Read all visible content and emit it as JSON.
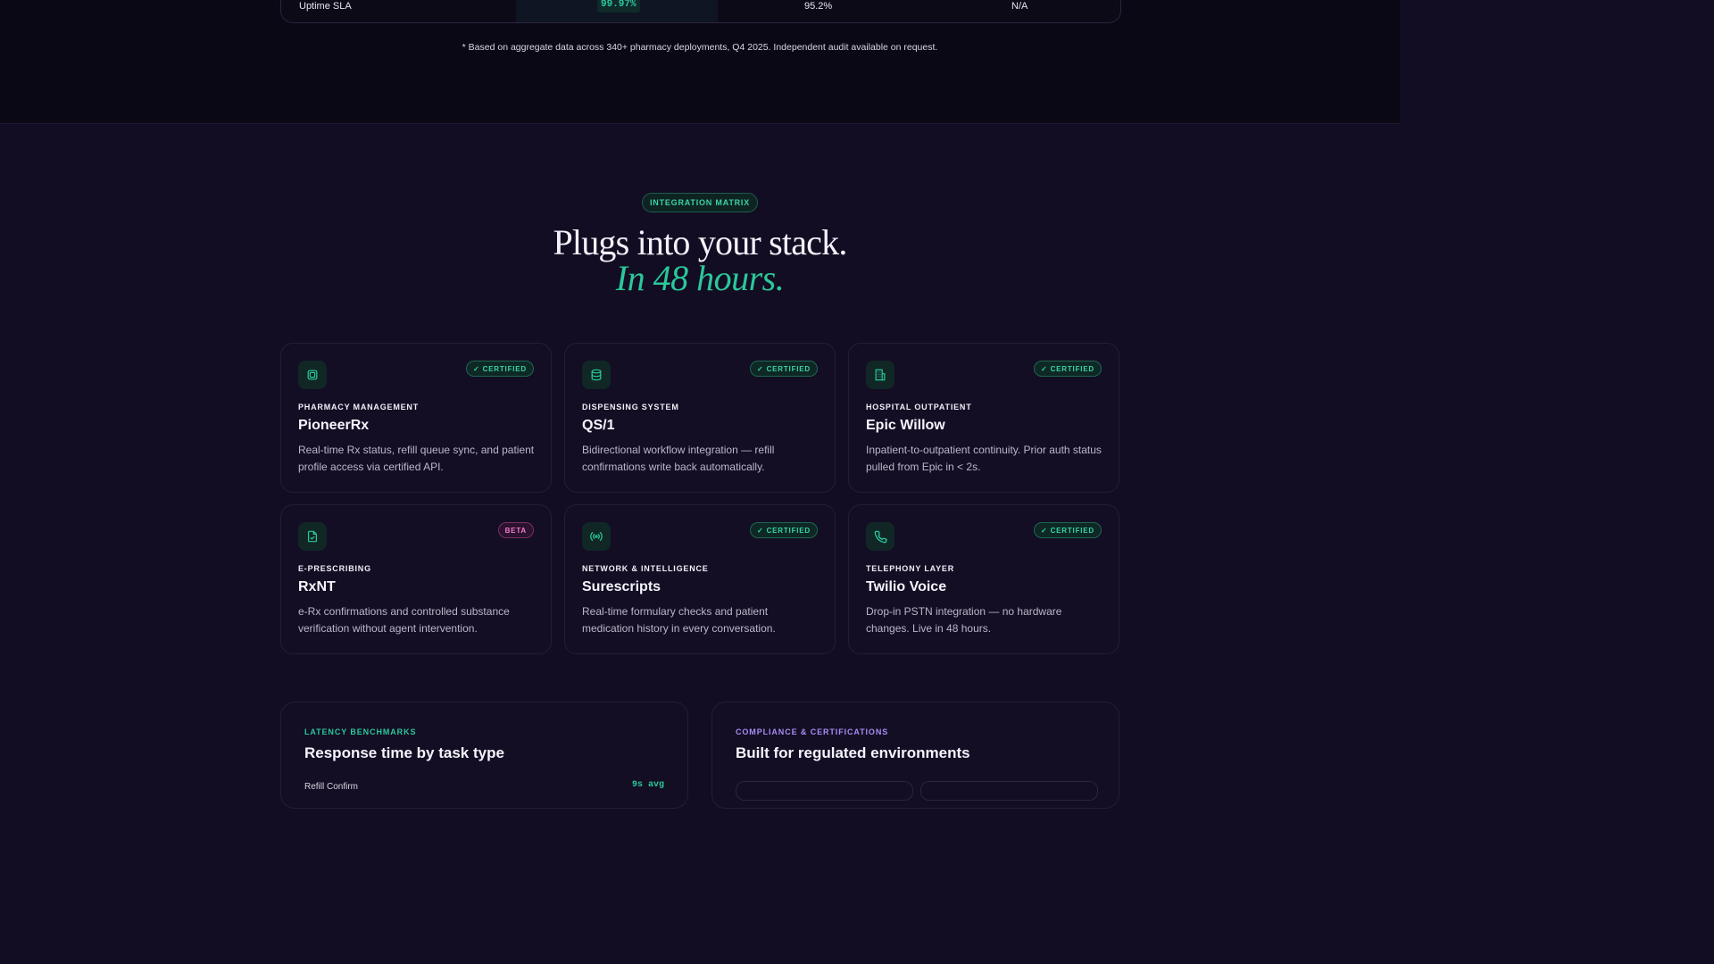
{
  "comparison_table": {
    "row_label": "Uptime SLA",
    "values": [
      "99.97%",
      "95.2%",
      "N/A"
    ],
    "footnote": "* Based on aggregate data across 340+ pharmacy deployments, Q4 2025. Independent audit available on request."
  },
  "integrations": {
    "eyebrow": "INTEGRATION MATRIX",
    "headline": "Plugs into your stack.",
    "headline_accent": "In 48 hours.",
    "cards": [
      {
        "icon": "chip-icon",
        "badge": "✓ CERTIFIED",
        "category": "PHARMACY MANAGEMENT",
        "name": "PioneerRx",
        "description": "Real-time Rx status, refill queue sync, and patient profile access via certified API."
      },
      {
        "icon": "database-icon",
        "badge": "✓ CERTIFIED",
        "category": "DISPENSING SYSTEM",
        "name": "QS/1",
        "description": "Bidirectional workflow integration — refill confirmations write back automatically."
      },
      {
        "icon": "building-icon",
        "badge": "✓ CERTIFIED",
        "category": "HOSPITAL OUTPATIENT",
        "name": "Epic Willow",
        "description": "Inpatient-to-outpatient continuity. Prior auth status pulled from Epic in < 2s."
      },
      {
        "icon": "file-check-icon",
        "badge": "BETA",
        "category": "E-PRESCRIBING",
        "name": "RxNT",
        "description": "e-Rx confirmations and controlled substance verification without agent intervention."
      },
      {
        "icon": "broadcast-icon",
        "badge": "✓ CERTIFIED",
        "category": "NETWORK & INTELLIGENCE",
        "name": "Surescripts",
        "description": "Real-time formulary checks and patient medication history in every conversation."
      },
      {
        "icon": "phone-icon",
        "badge": "✓ CERTIFIED",
        "category": "TELEPHONY LAYER",
        "name": "Twilio Voice",
        "description": "Drop-in PSTN integration — no hardware changes. Live in 48 hours."
      }
    ]
  },
  "latency_panel": {
    "eyebrow": "LATENCY BENCHMARKS",
    "title": "Response time by task type",
    "first_row_label": "Refill Confirm",
    "first_row_value": "9s avg"
  },
  "compliance_panel": {
    "eyebrow": "COMPLIANCE & CERTIFICATIONS",
    "title": "Built for regulated environments"
  },
  "colors": {
    "accent": "#2bc79a",
    "accent_purple": "#a98cf5",
    "beta_pink": "#f07ac5",
    "background": "#120d22"
  }
}
